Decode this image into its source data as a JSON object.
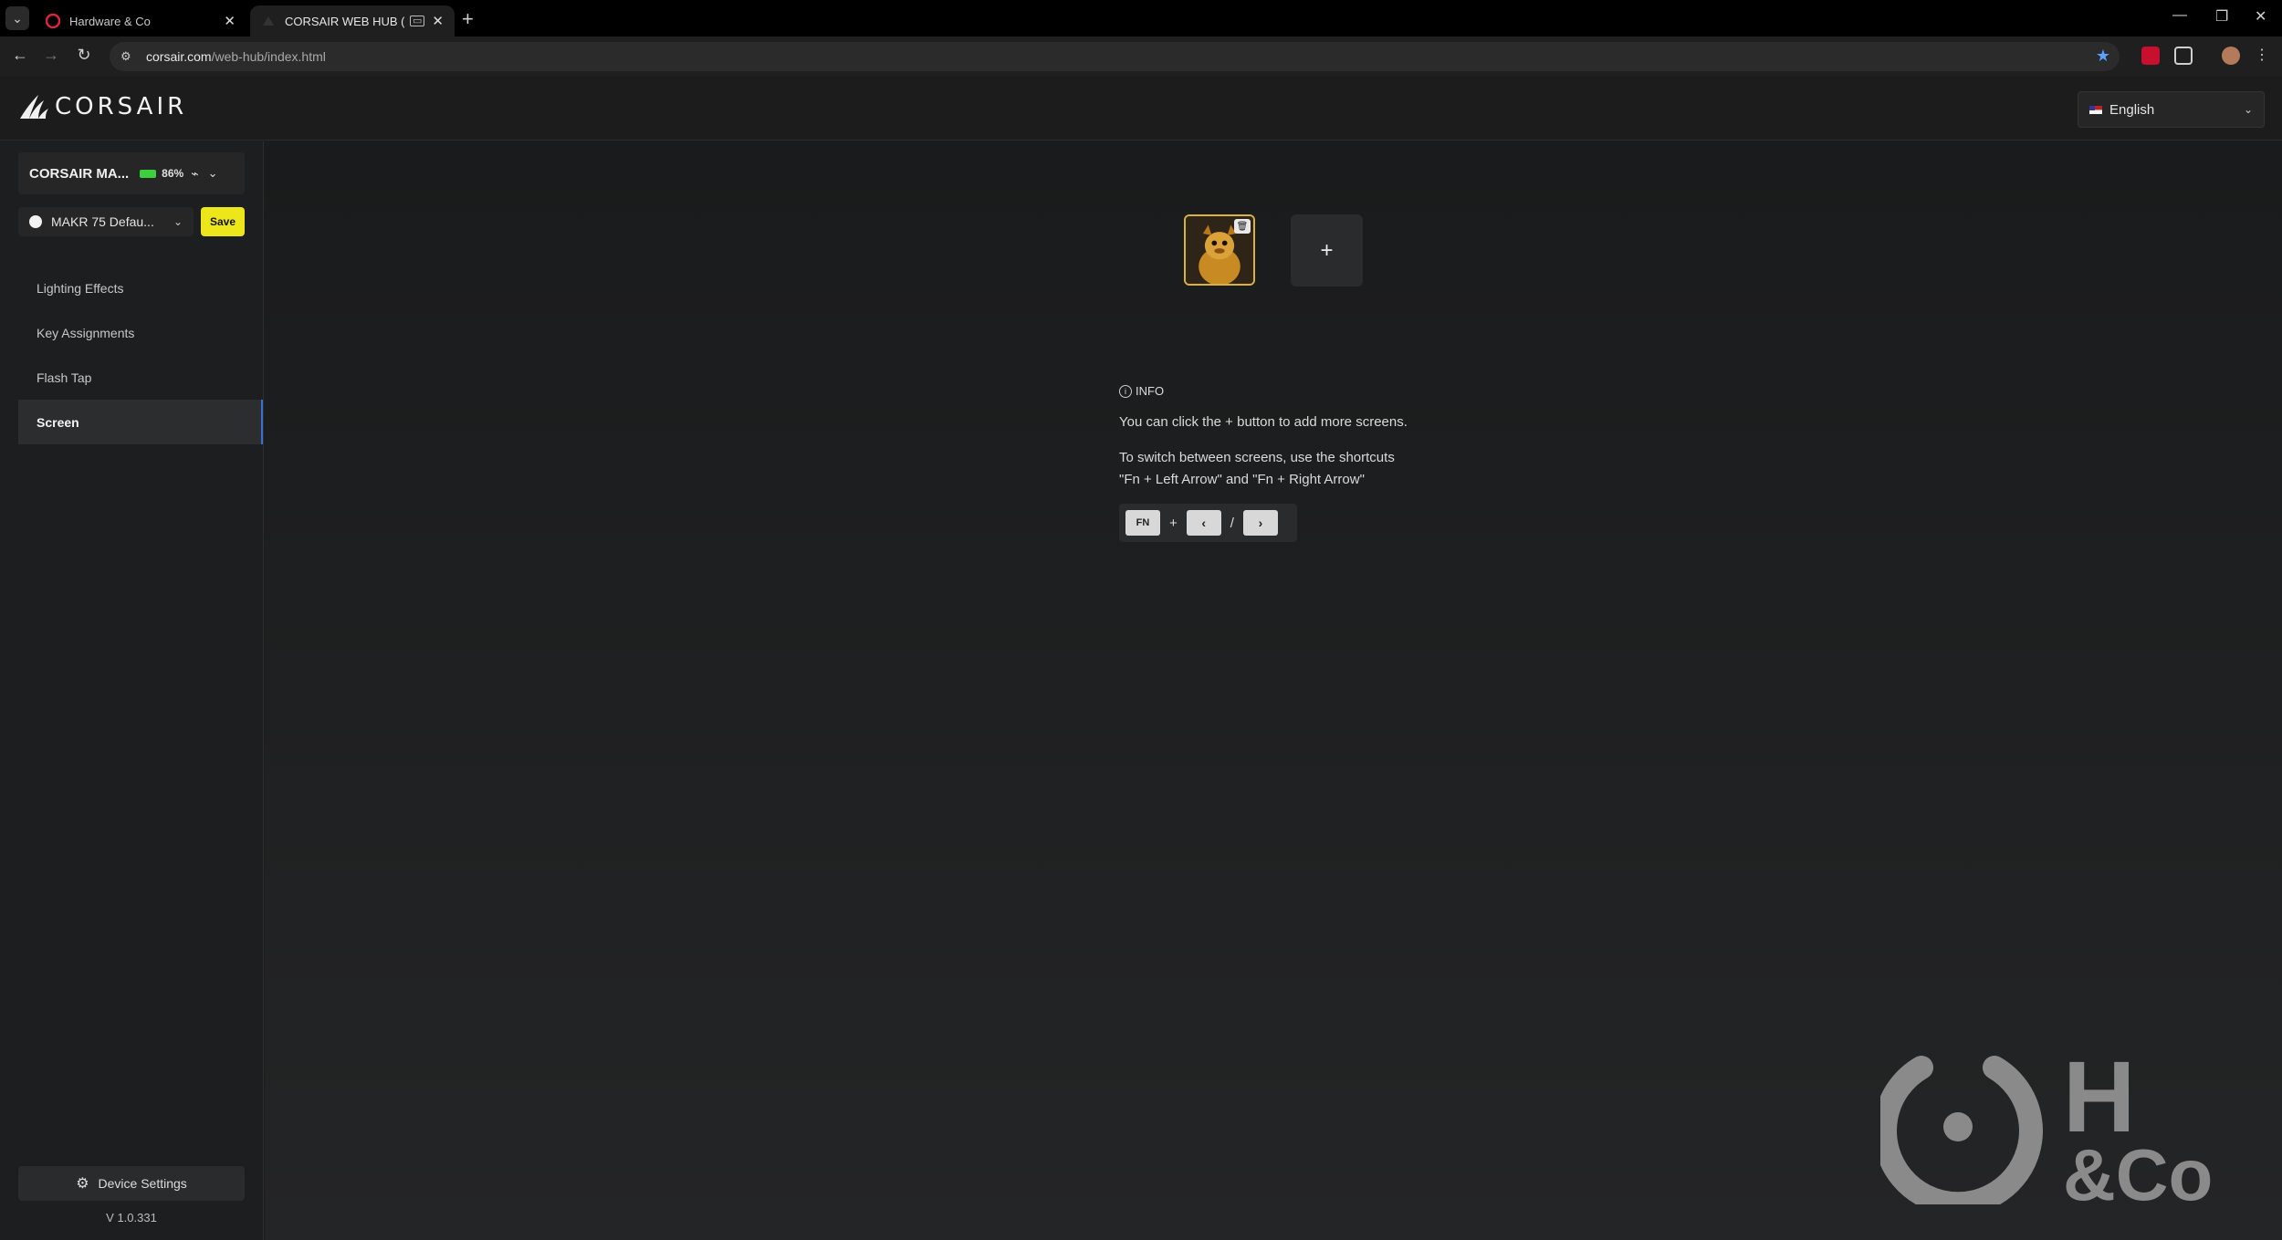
{
  "browser": {
    "tabs": [
      {
        "label": "Hardware & Co",
        "active": false
      },
      {
        "label": "CORSAIR WEB HUB (BETA)",
        "active": true
      }
    ],
    "url_host": "corsair.com",
    "url_path": "/web-hub/index.html"
  },
  "header": {
    "logo_text": "CORSAIR",
    "language": "English"
  },
  "sidebar": {
    "device_name": "CORSAIR MA...",
    "battery": "86%",
    "profile_name": "MAKR 75 Defau...",
    "save_label": "Save",
    "nav": [
      {
        "label": "Lighting Effects",
        "active": false
      },
      {
        "label": "Key Assignments",
        "active": false
      },
      {
        "label": "Flash Tap",
        "active": false
      },
      {
        "label": "Screen",
        "active": true
      }
    ],
    "device_settings_label": "Device Settings",
    "version": "V 1.0.331"
  },
  "main": {
    "add_label": "+",
    "info": {
      "title": "INFO",
      "line1": "You can click the + button to add more screens.",
      "line2a": "To switch between screens, use the shortcuts",
      "line2b": "\"Fn + Left Arrow\" and \"Fn + Right Arrow\""
    },
    "shortcut": {
      "fn": "FN",
      "plus": "+",
      "left": "‹",
      "slash": "/",
      "right": "›"
    }
  },
  "watermark": {
    "h": "H",
    "co": "&Co"
  },
  "colors": {
    "accent_save": "#ece61a",
    "battery": "#3ecf3e",
    "active_nav_border": "#3a6fd8",
    "thumb_border": "#d9b23a"
  }
}
